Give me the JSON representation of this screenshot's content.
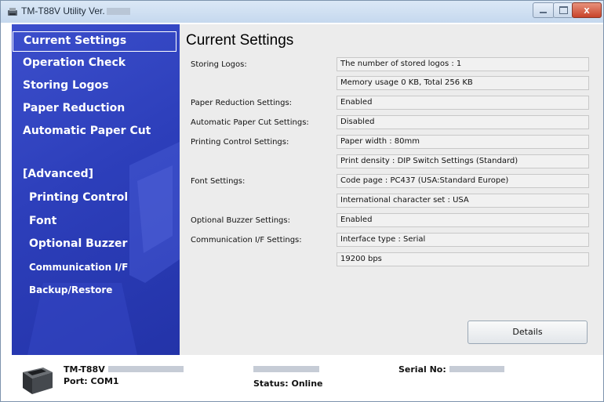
{
  "window": {
    "title": "TM-T88V Utility Ver.",
    "controls": {
      "close_label": "x"
    }
  },
  "sidebar": {
    "items": [
      {
        "label": "Current Settings"
      },
      {
        "label": "Operation Check"
      },
      {
        "label": "Storing Logos"
      },
      {
        "label": "Paper Reduction"
      },
      {
        "label": "Automatic Paper Cut"
      }
    ],
    "advanced_header": "[Advanced]",
    "advanced_items": [
      {
        "label": "Printing Control"
      },
      {
        "label": "Font"
      },
      {
        "label": "Optional Buzzer"
      },
      {
        "label": "Communication I/F"
      },
      {
        "label": "Backup/Restore"
      }
    ]
  },
  "main": {
    "title": "Current Settings",
    "settings": [
      {
        "label": "Storing Logos:",
        "values": [
          "The number of stored logos : 1",
          "Memory usage 0 KB, Total 256 KB"
        ]
      },
      {
        "label": "Paper Reduction Settings:",
        "values": [
          "Enabled"
        ]
      },
      {
        "label": "Automatic Paper Cut Settings:",
        "values": [
          "Disabled"
        ]
      },
      {
        "label": "Printing Control Settings:",
        "values": [
          "Paper width : 80mm",
          "Print density : DIP Switch Settings (Standard)"
        ]
      },
      {
        "label": "Font Settings:",
        "values": [
          "Code page : PC437 (USA:Standard Europe)",
          "International character set : USA"
        ]
      },
      {
        "label": "Optional Buzzer Settings:",
        "values": [
          "Enabled"
        ]
      },
      {
        "label": "Communication I/F Settings:",
        "values": [
          "Interface type : Serial",
          "19200 bps"
        ]
      }
    ],
    "details_button": "Details"
  },
  "status": {
    "model": "TM-T88V",
    "port": "Port: COM1",
    "status": "Status: Online",
    "serial": "Serial No:"
  }
}
